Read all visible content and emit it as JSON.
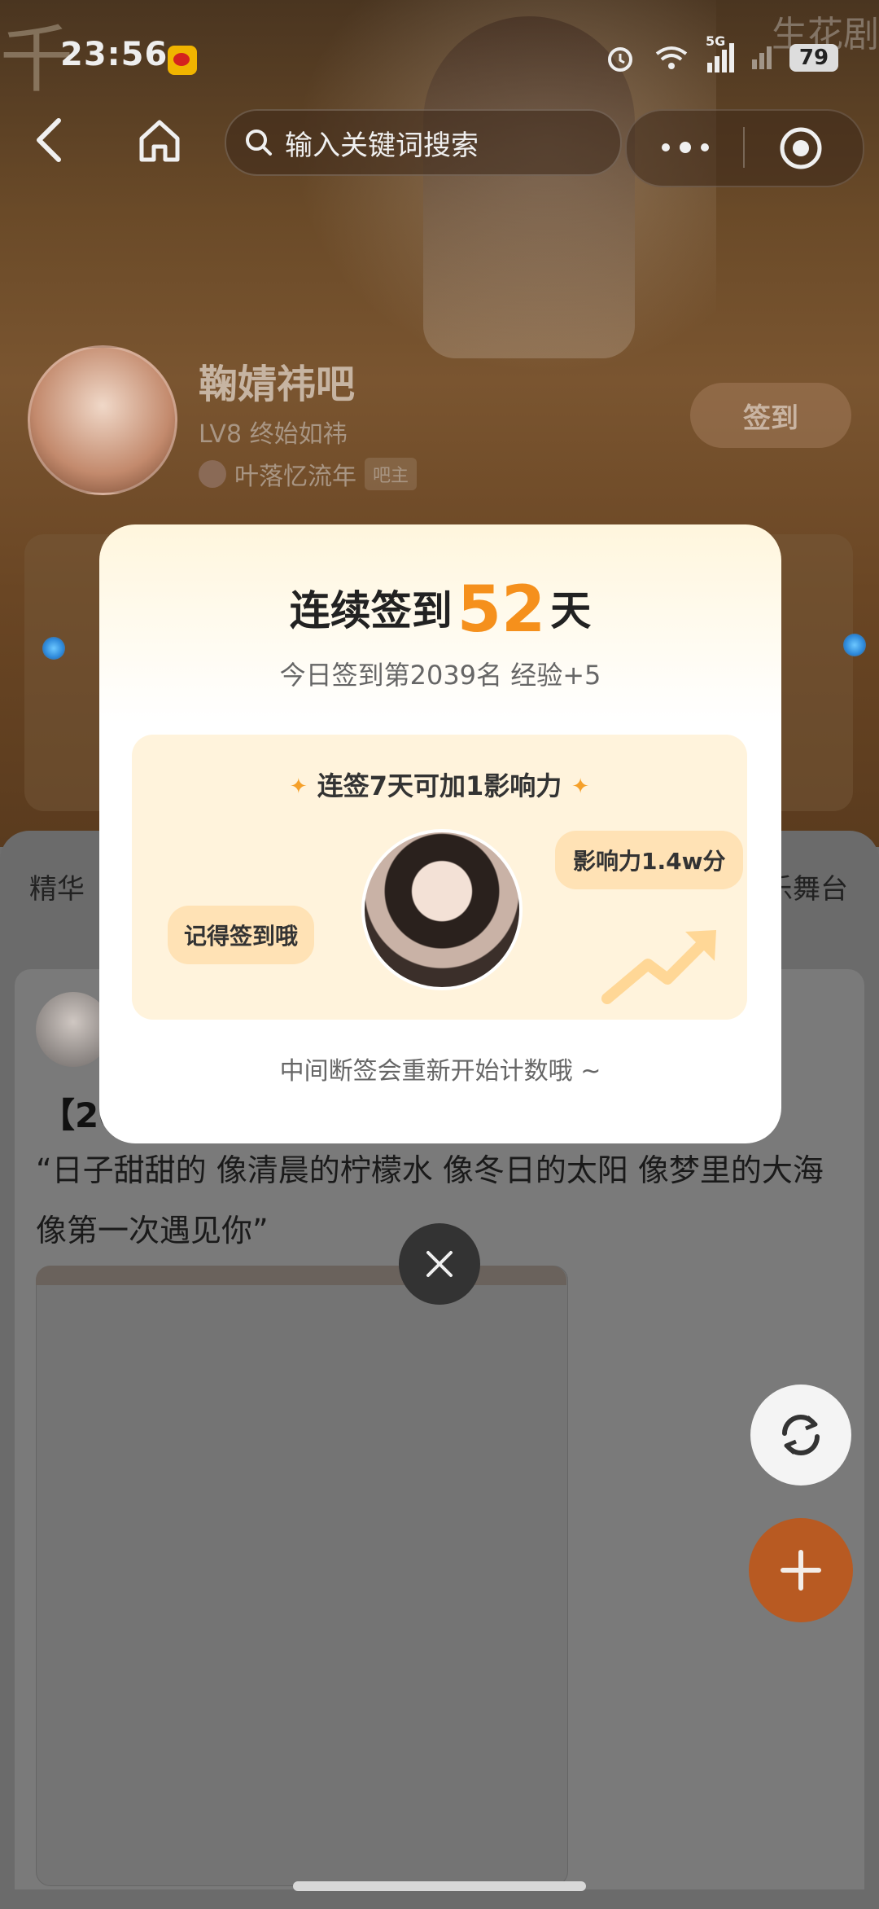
{
  "status_bar": {
    "time": "23:56",
    "network": "5G",
    "battery": "79"
  },
  "watermark": "生花剧",
  "nav": {
    "search_placeholder": "输入关键词搜索"
  },
  "forum": {
    "name": "鞠婧祎吧",
    "level": "LV8 终始如祎",
    "owner_name": "叶落忆流年",
    "owner_tag": "吧主",
    "sign_in_label": "签到"
  },
  "tabs": {
    "left": "精华",
    "right": "乐舞台"
  },
  "post": {
    "title_fragment": "【20",
    "body": "“日子甜甜的 像清晨的柠檬水 像冬日的太阳 像梦里的大海 像第一次遇见你”"
  },
  "modal": {
    "title_prefix": "连续签到",
    "streak_days": "52",
    "title_suffix": "天",
    "subtitle": "今日签到第2039名 经验+5",
    "reward_title": "连签7天可加1影响力",
    "bubble_left": "记得签到哦",
    "bubble_right": "影响力1.4w分",
    "footer": "中间断签会重新开始计数哦 ~"
  },
  "colors": {
    "accent": "#f5901c",
    "fab": "#b85a22",
    "bubble": "#ffe2b5"
  }
}
